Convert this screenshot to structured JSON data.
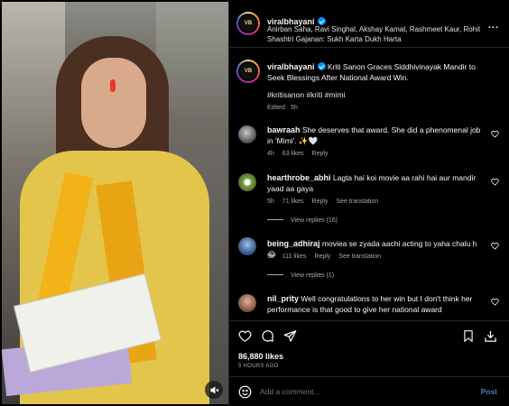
{
  "post": {
    "author": "viralbhayani",
    "tagged_people": "Anirban Saha, Ravi Singhal, Akshay Kamat, Rashmeet Kaur, Rohit Shashtri Gajanan: Sukh Karta Dukh Harta",
    "caption": "Kriti Sanon Graces Siddhivinayak Mandir to Seek Blessings After National Award Win.",
    "hashtags": "#kritisanon #kriti #mimi",
    "edited_meta": "Edited · 5h",
    "likes": "86,880 likes",
    "time_ago": "5 HOURS AGO",
    "comment_placeholder": "Add a comment...",
    "post_label": "Post",
    "more_icon": "..."
  },
  "comments": [
    {
      "user": "bawraah",
      "text": "She deserves that award. She did a phenomenal job in 'Mimi'. ✨🤍",
      "time": "4h",
      "likes": "63 likes",
      "reply": "Reply",
      "translation": "",
      "replies": ""
    },
    {
      "user": "hearthrobe_abhi",
      "text": "Lagta hai koi movie aa rahi hai aur mandir yaad aa gaya",
      "time": "5h",
      "likes": "71 likes",
      "reply": "Reply",
      "translation": "See translation",
      "replies": "View replies (16)"
    },
    {
      "user": "being_adhiraj",
      "text": "moviea se zyada aachi acting to yaha chalu h 😂",
      "time": "5h",
      "likes": "111 likes",
      "reply": "Reply",
      "translation": "See translation",
      "replies": "View replies (1)"
    },
    {
      "user": "nil_prity",
      "text": "Well congratulations to her win but I don't think her performance is that good to give her national award",
      "time": "",
      "likes": "",
      "reply": "",
      "translation": "",
      "replies": ""
    }
  ],
  "colors": {
    "accent": "#0095f6",
    "background": "#000000",
    "muted": "#a8a8a8",
    "post_button": "#4a7fb3"
  }
}
